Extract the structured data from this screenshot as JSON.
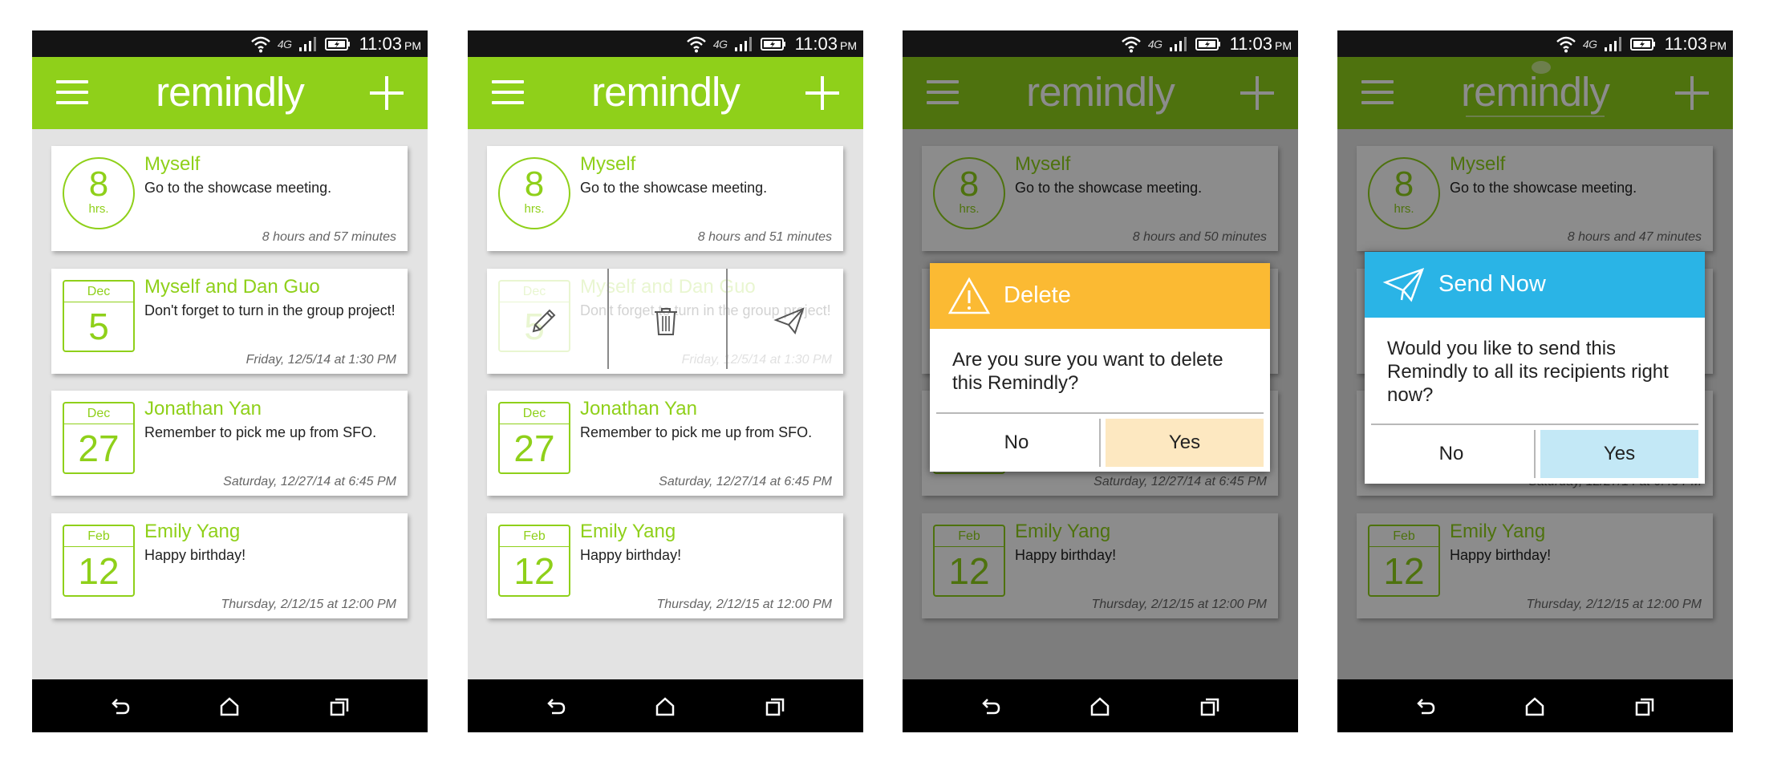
{
  "status": {
    "network": "4G",
    "time": "11:03",
    "ampm": "PM"
  },
  "app": {
    "title": "remindly"
  },
  "reminders": [
    {
      "name": "Myself",
      "message": "Go to the showcase meeting.",
      "badge_type": "countdown",
      "badge_value": "8",
      "badge_unit": "hrs."
    },
    {
      "name": "Myself and Dan Guo",
      "message": "Don't forget to turn in the group project!",
      "badge_type": "date",
      "month": "Dec",
      "day": "5",
      "time_text": "Friday, 12/5/14 at 1:30 PM"
    },
    {
      "name": "Jonathan Yan",
      "message": "Remember to pick me up from SFO.",
      "badge_type": "date",
      "month": "Dec",
      "day": "27",
      "time_text": "Saturday, 12/27/14 at 6:45 PM"
    },
    {
      "name": "Emily Yang",
      "message": "Happy birthday!",
      "badge_type": "date",
      "month": "Feb",
      "day": "12",
      "time_text": "Thursday, 2/12/15 at 12:00 PM"
    }
  ],
  "screens": [
    {
      "first_card_time": "8 hours and 57 minutes"
    },
    {
      "first_card_time": "8 hours and 51 minutes",
      "swipe_actions": [
        "pencil-icon",
        "trash-icon",
        "paper-plane-icon"
      ]
    },
    {
      "first_card_time": "8 hours and 50 minutes"
    },
    {
      "first_card_time": "8 hours and 47 minutes"
    }
  ],
  "dialogs": {
    "delete": {
      "title": "Delete",
      "icon": "warning-icon",
      "message": "Are you sure you want to delete this Remindly?",
      "no_label": "No",
      "yes_label": "Yes",
      "header_color": "#fbba33",
      "yes_bg": "#fde8c1"
    },
    "send": {
      "title": "Send Now",
      "icon": "paper-plane-icon",
      "message": "Would you like to send this Remindly to all its recipients right now?",
      "no_label": "No",
      "yes_label": "Yes",
      "header_color": "#2ab4e6",
      "yes_bg": "#c3e8f6"
    }
  },
  "colors": {
    "accent": "#8fd01a",
    "background": "#e3e3e3",
    "statusbar": "#141414",
    "navbar": "#000000"
  },
  "nav_icons": [
    "back-icon",
    "home-icon",
    "recents-icon"
  ]
}
